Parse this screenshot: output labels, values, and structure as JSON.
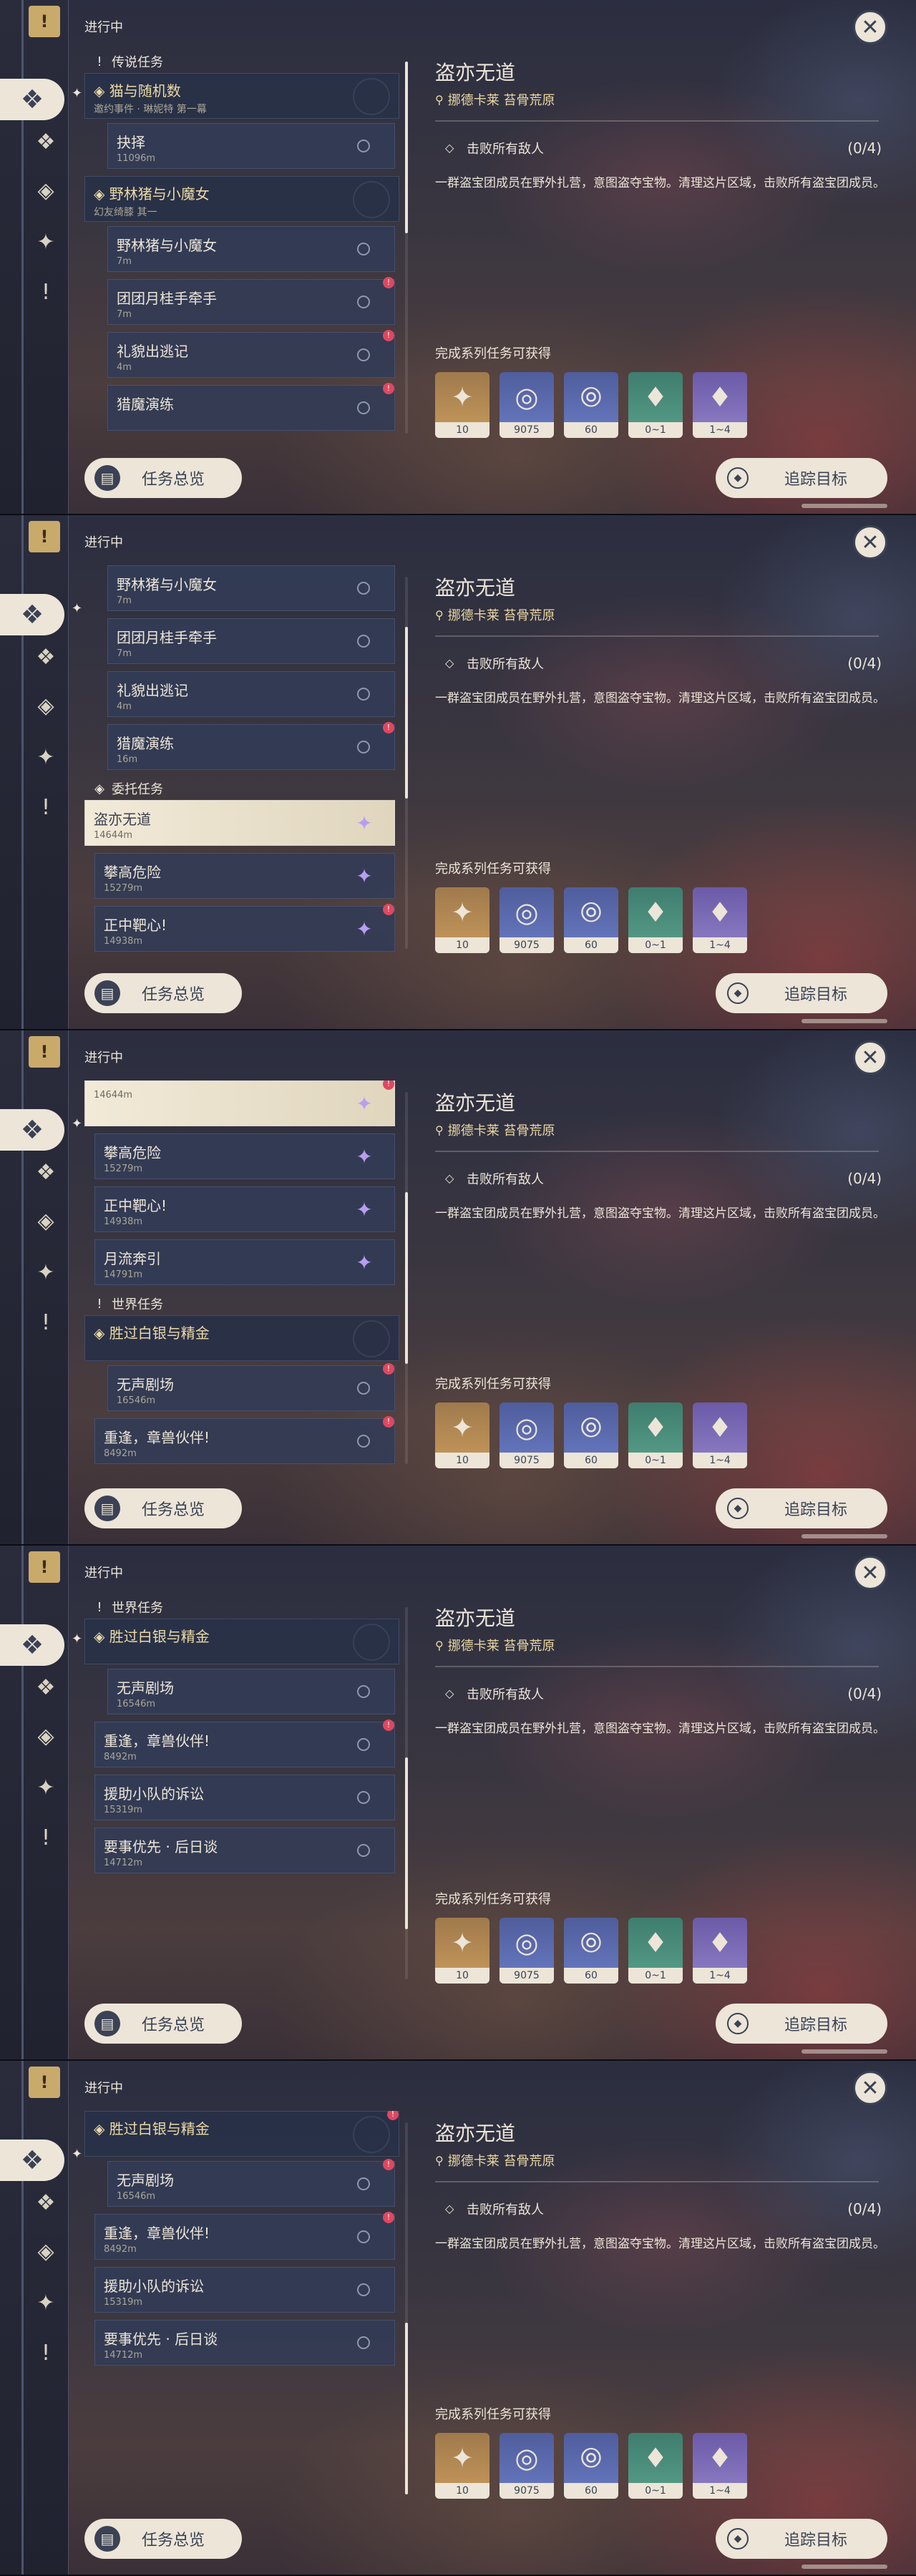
{
  "ui": {
    "header_label": "进行中",
    "overview_label": "任务总览",
    "track_label": "追踪目标",
    "close_glyph": "✕"
  },
  "rail": {
    "items": [
      "tier-quest-icon",
      "all-quests-icon",
      "archon-quest-icon",
      "world-quest-icon",
      "alert-icon"
    ]
  },
  "detail": {
    "title": "盗亦无道",
    "location": "挪德卡莱 苔骨荒原",
    "objective": "击败所有敌人",
    "progress": "(0/4)",
    "description": "一群盗宝团成员在野外扎营，意图盗夺宝物。清理这片区域，击败所有盗宝团成员。",
    "reward_label": "完成系列任务可获得",
    "rewards": [
      {
        "icon": "primogem",
        "count": "10",
        "color": "orange"
      },
      {
        "icon": "mora",
        "count": "9075",
        "color": "blue"
      },
      {
        "icon": "adventure-exp",
        "count": "60",
        "color": "blue"
      },
      {
        "icon": "crystal-small",
        "count": "0~1",
        "color": "green"
      },
      {
        "icon": "crystal-large",
        "count": "1~4",
        "color": "purple"
      }
    ]
  },
  "frames": [
    {
      "sections": [
        {
          "type": "section",
          "glyph": "!",
          "title": "传说任务"
        },
        {
          "type": "group",
          "title": "猫与随机数",
          "sub": "邀约事件 · 琳妮特 第一幕"
        },
        {
          "type": "item",
          "name": "抉择",
          "dist": "11096m",
          "nested": true
        },
        {
          "type": "group",
          "title": "野林猪与小魔女",
          "sub": "幻友绮膝 其一"
        },
        {
          "type": "item",
          "name": "野林猪与小魔女",
          "dist": "7m",
          "nested": true
        },
        {
          "type": "item",
          "name": "团团月桂手牵手",
          "dist": "7m",
          "nested": true,
          "alert": true
        },
        {
          "type": "item",
          "name": "礼貌出逃记",
          "dist": "4m",
          "nested": true,
          "alert": true
        },
        {
          "type": "item",
          "name": "猎魔演练",
          "dist": "",
          "nested": true,
          "alert": true
        }
      ]
    },
    {
      "sections": [
        {
          "type": "item",
          "name": "野林猪与小魔女",
          "dist": "7m",
          "nested": true
        },
        {
          "type": "item",
          "name": "团团月桂手牵手",
          "dist": "7m",
          "nested": true
        },
        {
          "type": "item",
          "name": "礼貌出逃记",
          "dist": "4m",
          "nested": true
        },
        {
          "type": "item",
          "name": "猎魔演练",
          "dist": "16m",
          "nested": true,
          "alert": true
        },
        {
          "type": "section",
          "glyph": "◈",
          "title": "委托任务"
        },
        {
          "type": "item",
          "name": "盗亦无道",
          "dist": "14644m",
          "sel": true,
          "purple": true
        },
        {
          "type": "item",
          "name": "攀高危险",
          "dist": "15279m",
          "purple": true
        },
        {
          "type": "item",
          "name": "正中靶心!",
          "dist": "14938m",
          "purple": true,
          "alert": true
        }
      ]
    },
    {
      "sections": [
        {
          "type": "item",
          "name": "",
          "dist": "14644m",
          "sel": true,
          "purple": true,
          "alert": true
        },
        {
          "type": "item",
          "name": "攀高危险",
          "dist": "15279m",
          "purple": true
        },
        {
          "type": "item",
          "name": "正中靶心!",
          "dist": "14938m",
          "purple": true
        },
        {
          "type": "item",
          "name": "月流奔引",
          "dist": "14791m",
          "purple": true
        },
        {
          "type": "section",
          "glyph": "!",
          "title": "世界任务"
        },
        {
          "type": "group",
          "title": "胜过白银与精金",
          "sub": ""
        },
        {
          "type": "item",
          "name": "无声剧场",
          "dist": "16546m",
          "nested": true,
          "alert": true
        },
        {
          "type": "item",
          "name": "重逢，章兽伙伴!",
          "dist": "8492m",
          "alert": true
        }
      ]
    },
    {
      "sections": [
        {
          "type": "section",
          "glyph": "!",
          "title": "世界任务"
        },
        {
          "type": "group",
          "title": "胜过白银与精金",
          "sub": ""
        },
        {
          "type": "item",
          "name": "无声剧场",
          "dist": "16546m",
          "nested": true
        },
        {
          "type": "item",
          "name": "重逢，章兽伙伴!",
          "dist": "8492m",
          "alert": true
        },
        {
          "type": "item",
          "name": "援助小队的诉讼",
          "dist": "15319m"
        },
        {
          "type": "item",
          "name": "要事优先 · 后日谈",
          "dist": "14712m"
        }
      ]
    },
    {
      "sections": [
        {
          "type": "group",
          "title": "胜过白银与精金",
          "sub": "",
          "alert": true
        },
        {
          "type": "item",
          "name": "无声剧场",
          "dist": "16546m",
          "nested": true,
          "alert": true
        },
        {
          "type": "item",
          "name": "重逢，章兽伙伴!",
          "dist": "8492m",
          "alert": true
        },
        {
          "type": "item",
          "name": "援助小队的诉讼",
          "dist": "15319m"
        },
        {
          "type": "item",
          "name": "要事优先 · 后日谈",
          "dist": "14712m"
        }
      ]
    }
  ]
}
